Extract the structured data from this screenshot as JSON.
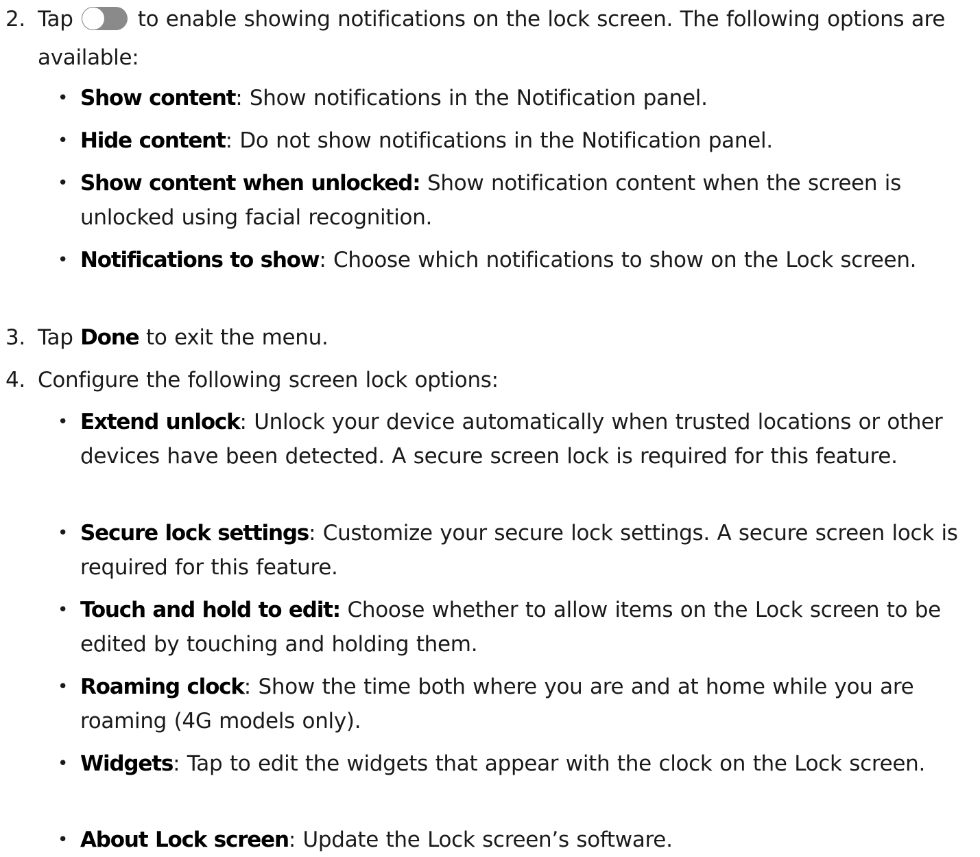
{
  "steps": [
    {
      "num": "2.",
      "before_toggle": "Tap",
      "toggle_icon": "toggle-switch-icon",
      "after_toggle": "to enable showing notifications on the lock screen. The following options are available:",
      "bullets": [
        {
          "term": "Show content",
          "desc": ": Show notifications in the Notification panel."
        },
        {
          "term": "Hide content",
          "desc": ": Do not show notifications in the Notification panel."
        },
        {
          "term": "Show content when unlocked:",
          "desc": " Show notification content when the screen is unlocked using facial recognition."
        },
        {
          "term": "Notifications to show",
          "desc": ": Choose which notifications to show on the Lock screen."
        }
      ]
    },
    {
      "num": "3.",
      "before_bold": "Tap ",
      "bold": "Done",
      "after_bold": " to exit the menu."
    },
    {
      "num": "4.",
      "text": "Configure the following screen lock options:",
      "bullets": [
        {
          "term": "Extend unlock",
          "desc": ": Unlock your device automatically when trusted locations or other devices have been detected. A secure screen lock is required for this feature."
        },
        {
          "term": "Secure lock settings",
          "desc": ": Customize your secure lock settings. A secure screen lock is required for this feature."
        },
        {
          "term": "Touch and hold to edit:",
          "desc": " Choose whether to allow items on the Lock screen to be edited by touching and holding them."
        },
        {
          "term": "Roaming clock",
          "desc": ": Show the time both where you are and at home while you are roaming (4G models only)."
        },
        {
          "term": "Widgets",
          "desc": ": Tap to edit the widgets that appear with the clock on the Lock screen."
        },
        {
          "term": "About Lock screen",
          "desc": ": Update the Lock screen’s software."
        }
      ]
    }
  ]
}
